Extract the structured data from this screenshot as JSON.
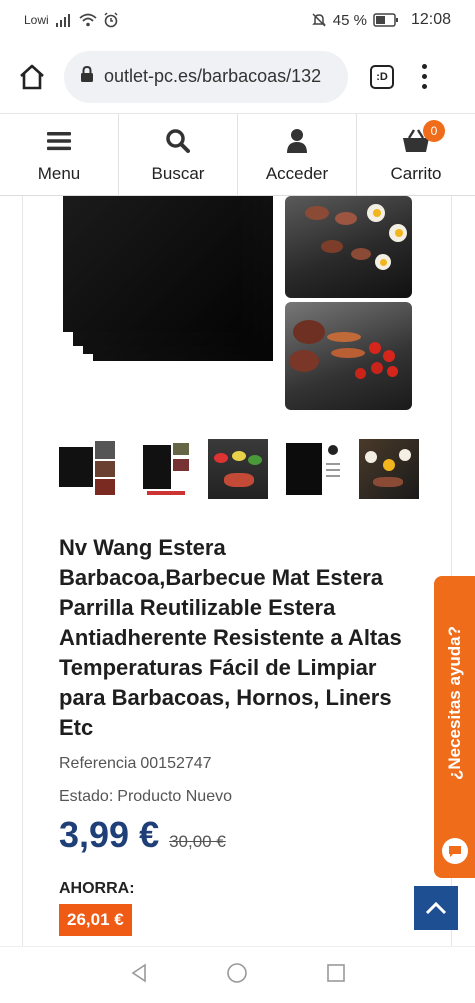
{
  "status": {
    "carrier": "Lowi",
    "battery_pct": "45 %",
    "time": "12:08",
    "icons": [
      "signal-icon",
      "wifi-icon",
      "alarm-icon",
      "mute-icon",
      "battery-icon"
    ]
  },
  "browser": {
    "url": "outlet-pc.es/barbacoas/132",
    "tabs_label": ":D"
  },
  "nav": {
    "menu": "Menu",
    "search": "Buscar",
    "login": "Acceder",
    "cart": "Carrito",
    "cart_count": "0"
  },
  "product": {
    "title": "Nv Wang Estera Barbacoa,Barbecue Mat Estera Parrilla Reutilizable Estera Antiadherente Resistente a Altas Temperaturas Fácil de Limpiar para Barbacoas, Hornos, Liners Etc",
    "reference_label": "Referencia",
    "reference_value": "00152747",
    "condition_label": "Estado:",
    "condition_value": "Producto Nuevo",
    "price": "3,99 €",
    "old_price": "30,00 €",
    "savings_label": "AHORRA:",
    "savings_value": "26,01 €"
  },
  "help": {
    "label": "¿Necesitas ayuda?"
  },
  "colors": {
    "accent_orange": "#ef6c1a",
    "price_blue": "#1f3f79",
    "button_blue": "#1f4f93"
  }
}
